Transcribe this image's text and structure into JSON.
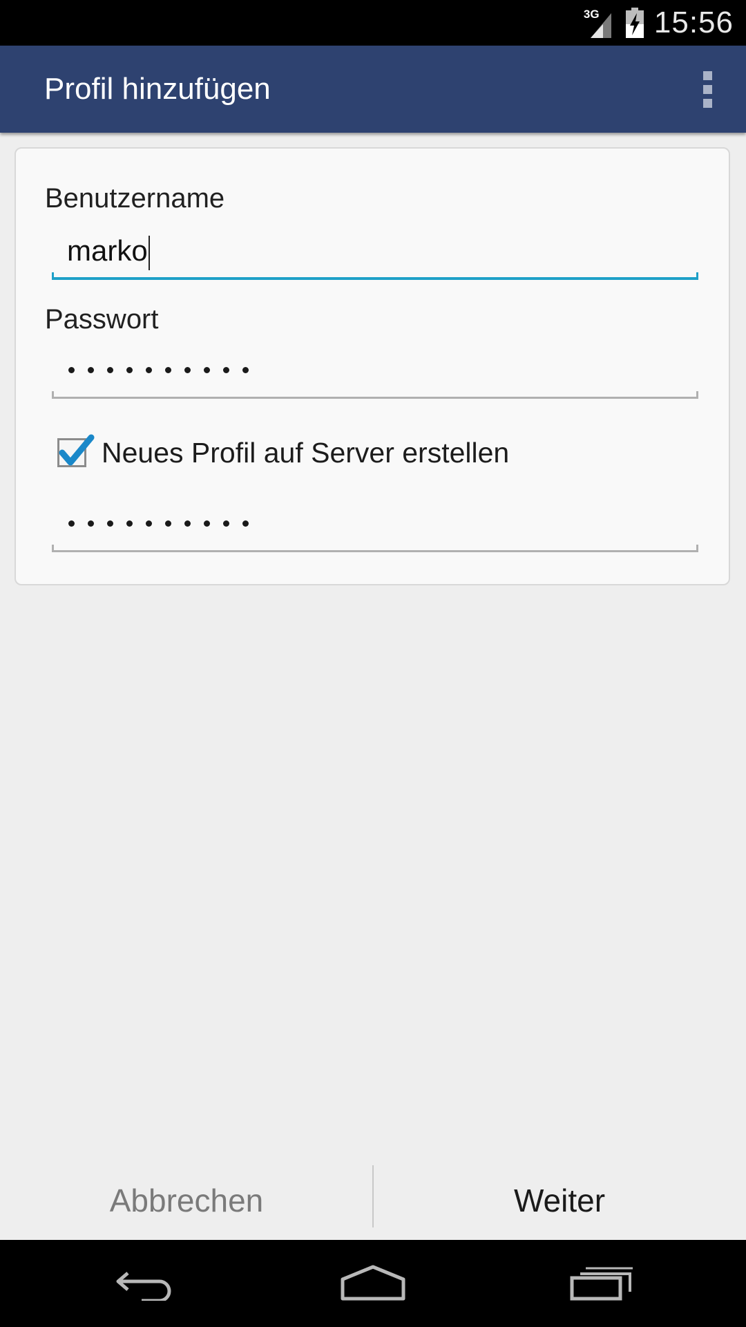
{
  "status_bar": {
    "time": "15:56",
    "network_label": "3G",
    "signal_icon": "signal-icon",
    "battery_icon": "battery-charging-icon"
  },
  "action_bar": {
    "title": "Profil hinzufügen",
    "overflow_icon": "overflow-menu-icon"
  },
  "form": {
    "username_label": "Benutzername",
    "username_value": "marko",
    "password_label": "Passwort",
    "password_length": 10,
    "create_on_server_label": "Neues Profil auf Server erstellen",
    "create_on_server_checked": true,
    "password_confirm_length": 10
  },
  "buttons": {
    "cancel_label": "Abbrechen",
    "next_label": "Weiter"
  },
  "navigation": {
    "back_icon": "back-icon",
    "home_icon": "home-icon",
    "recents_icon": "recents-icon"
  },
  "colors": {
    "action_bar": "#2e4270",
    "accent": "#1ea0c8",
    "checkmark": "#1a88c9"
  }
}
